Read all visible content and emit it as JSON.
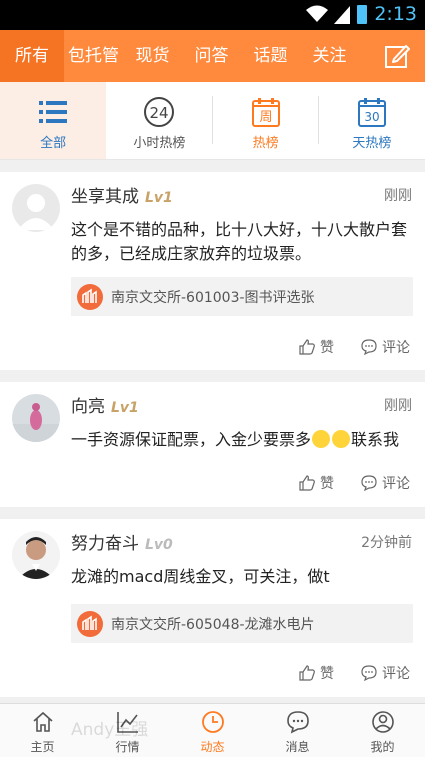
{
  "status": {
    "time": "2:13"
  },
  "topnav": {
    "tabs": [
      "所有",
      "包托管",
      "现货",
      "问答",
      "话题",
      "关注"
    ],
    "active": 0
  },
  "subnav": {
    "items": [
      {
        "label": "全部",
        "icon": "list-icon"
      },
      {
        "label": "小时热榜",
        "icon": "clock-24-icon",
        "badge": "24"
      },
      {
        "label": "热榜",
        "icon": "week-calendar-icon",
        "badge": "周"
      },
      {
        "label": "天热榜",
        "icon": "calendar-30-icon",
        "badge": "30"
      }
    ]
  },
  "feed": [
    {
      "user": "坐享其成",
      "level": "Lv1",
      "time": "刚刚",
      "content": "这个是不错的品种，比十八大好，十八大散户套的多，已经成庄家放弃的垃圾票。",
      "link": "南京文交所-601003-图书评选张",
      "like": "赞",
      "comment": "评论"
    },
    {
      "user": "向亮",
      "level": "Lv1",
      "time": "刚刚",
      "content_prefix": "一手资源保证配票，入金少要票多",
      "content_suffix": "联系我",
      "like": "赞",
      "comment": "评论"
    },
    {
      "user": "努力奋斗",
      "level": "Lv0",
      "time": "2分钟前",
      "content": "龙滩的macd周线金叉，可关注，做t",
      "link": "南京文交所-605048-龙滩水电片",
      "like": "赞",
      "comment": "评论"
    }
  ],
  "ghost_user": "Andy王强",
  "bottomnav": {
    "items": [
      {
        "label": "主页",
        "icon": "home-icon"
      },
      {
        "label": "行情",
        "icon": "chart-icon"
      },
      {
        "label": "动态",
        "icon": "clock-icon"
      },
      {
        "label": "消息",
        "icon": "message-icon"
      },
      {
        "label": "我的",
        "icon": "user-icon"
      }
    ],
    "active": 2
  },
  "colors": {
    "accent": "#ff8a3d",
    "active_tab": "#f57424",
    "link_blue": "#2c77c0"
  }
}
